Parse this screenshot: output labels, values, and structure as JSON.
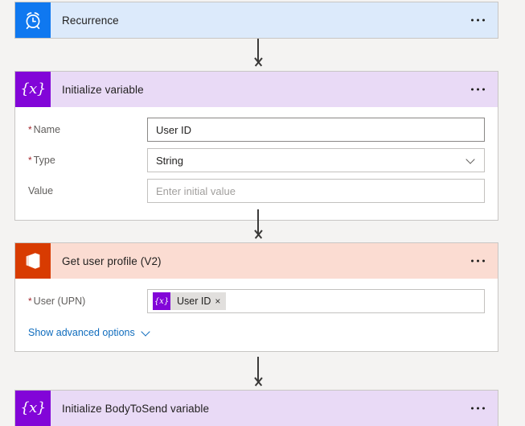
{
  "canvas": {
    "background_color": "#f4f3f2"
  },
  "colors": {
    "trigger_header": "#dceafb",
    "trigger_icon": "#0f78f0",
    "variable_header": "#e9daf6",
    "variable_icon": "#8205d8",
    "office_header": "#fbdcd2",
    "office_icon": "#d83b01",
    "link": "#0f6cbd",
    "required_asterisk": "#a4262c",
    "connector": "#3b3a39"
  },
  "cards": [
    {
      "id": "recurrence",
      "title": "Recurrence",
      "icon": "alarm-clock-icon",
      "menu": "more-options-icon"
    },
    {
      "id": "initialize-variable",
      "title": "Initialize variable",
      "icon": "variable-icon",
      "icon_glyph": "{x}",
      "menu": "more-options-icon",
      "fields": [
        {
          "label": "Name",
          "required": true,
          "value": "User ID",
          "placeholder": "",
          "control": "text"
        },
        {
          "label": "Type",
          "required": true,
          "value": "String",
          "placeholder": "",
          "control": "dropdown"
        },
        {
          "label": "Value",
          "required": false,
          "value": "",
          "placeholder": "Enter initial value",
          "control": "text"
        }
      ]
    },
    {
      "id": "get-user-profile",
      "title": "Get user profile (V2)",
      "icon": "office-365-icon",
      "menu": "more-options-icon",
      "fields": [
        {
          "label": "User (UPN)",
          "required": true,
          "control": "token",
          "token": {
            "badge_glyph": "{x}",
            "text": "User ID",
            "remove": "×"
          }
        }
      ],
      "advanced_options_label": "Show advanced options"
    },
    {
      "id": "initialize-bodytosend-variable",
      "title": "Initialize BodyToSend variable",
      "icon": "variable-icon",
      "icon_glyph": "{x}",
      "menu": "more-options-icon"
    }
  ]
}
